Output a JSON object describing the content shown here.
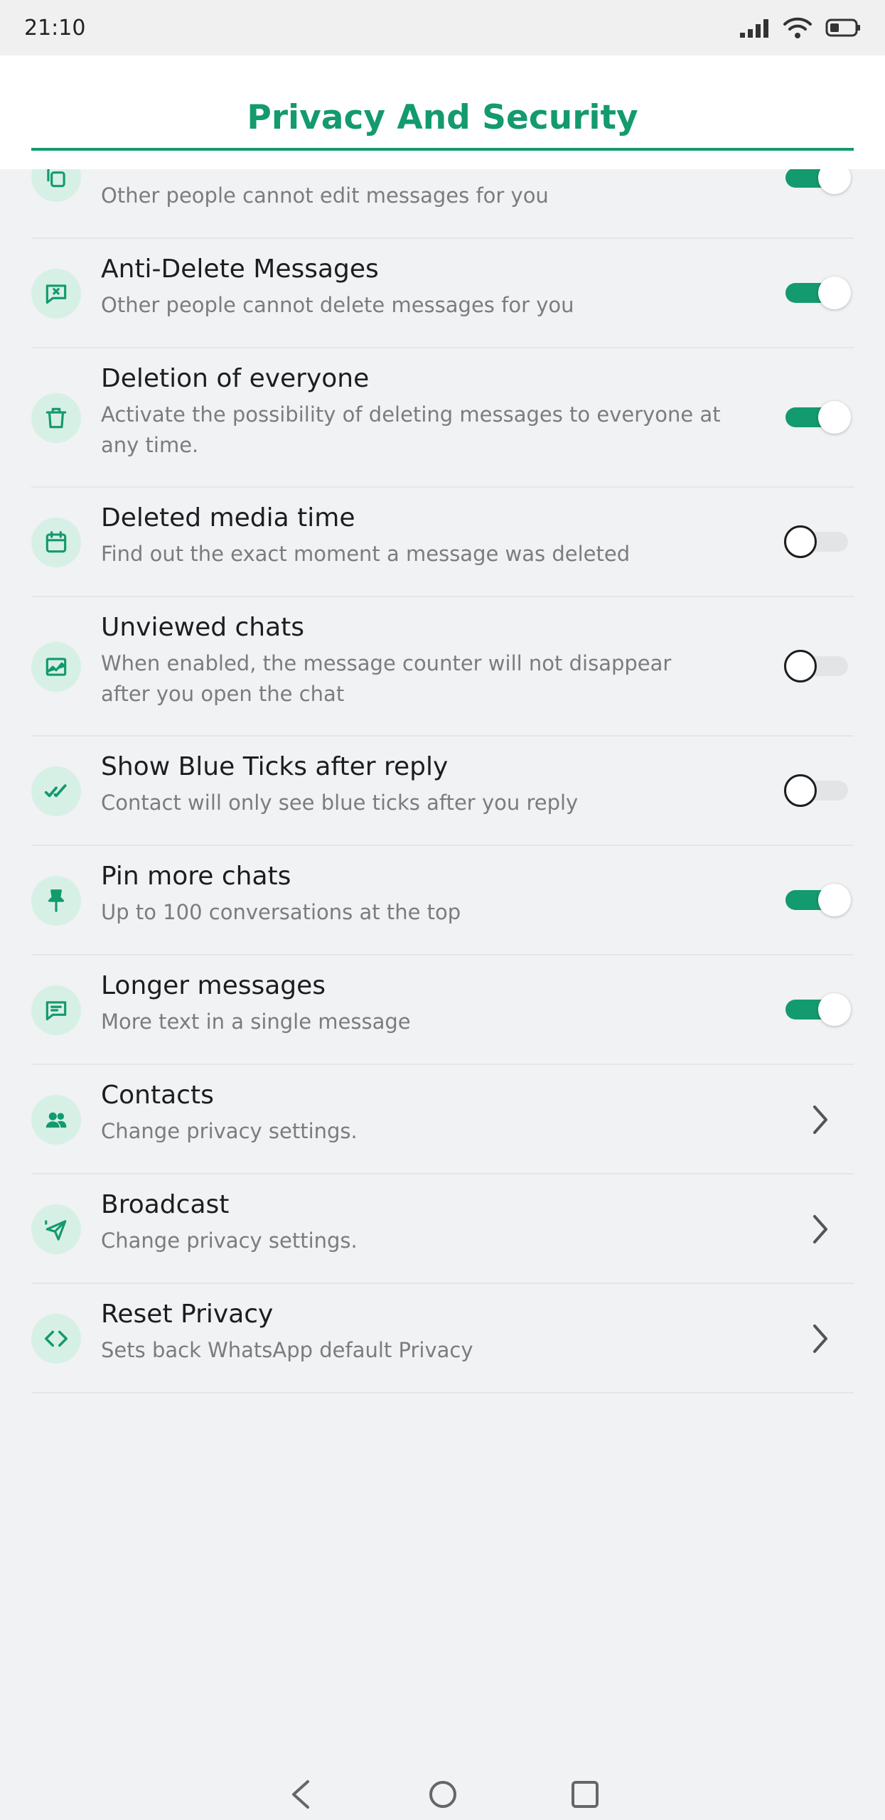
{
  "status_bar": {
    "time": "21:10"
  },
  "header": {
    "title": "Privacy And Security"
  },
  "colors": {
    "accent": "#139a6e",
    "icon_bg": "#d7f0e6"
  },
  "items": [
    {
      "title": "",
      "subtitle": "Other people cannot edit messages for you",
      "control": "toggle",
      "enabled": true,
      "icon": "copy-icon"
    },
    {
      "title": "Anti-Delete Messages",
      "subtitle": "Other people cannot delete messages for you",
      "control": "toggle",
      "enabled": true,
      "icon": "message-x-icon"
    },
    {
      "title": "Deletion of everyone",
      "subtitle": "Activate the possibility of deleting messages to everyone at any time.",
      "control": "toggle",
      "enabled": true,
      "icon": "trash-icon"
    },
    {
      "title": "Deleted media time",
      "subtitle": "Find out the exact moment a message was deleted",
      "control": "toggle",
      "enabled": false,
      "icon": "calendar-icon"
    },
    {
      "title": "Unviewed chats",
      "subtitle": "When enabled, the message counter will not disappear after you open the chat",
      "control": "toggle",
      "enabled": false,
      "icon": "image-chart-icon"
    },
    {
      "title": "Show Blue Ticks after reply",
      "subtitle": "Contact will only see blue ticks after you reply",
      "control": "toggle",
      "enabled": false,
      "icon": "double-check-icon"
    },
    {
      "title": "Pin more chats",
      "subtitle": "Up to 100 conversations at the top",
      "control": "toggle",
      "enabled": true,
      "icon": "pin-icon"
    },
    {
      "title": "Longer messages",
      "subtitle": "More text in a single message",
      "control": "toggle",
      "enabled": true,
      "icon": "message-lines-icon"
    },
    {
      "title": "Contacts",
      "subtitle": "Change privacy settings.",
      "control": "chevron",
      "icon": "contacts-icon"
    },
    {
      "title": "Broadcast",
      "subtitle": "Change privacy settings.",
      "control": "chevron",
      "icon": "send-icon"
    },
    {
      "title": "Reset Privacy",
      "subtitle": "Sets back WhatsApp default Privacy",
      "control": "chevron",
      "icon": "code-icon"
    }
  ]
}
